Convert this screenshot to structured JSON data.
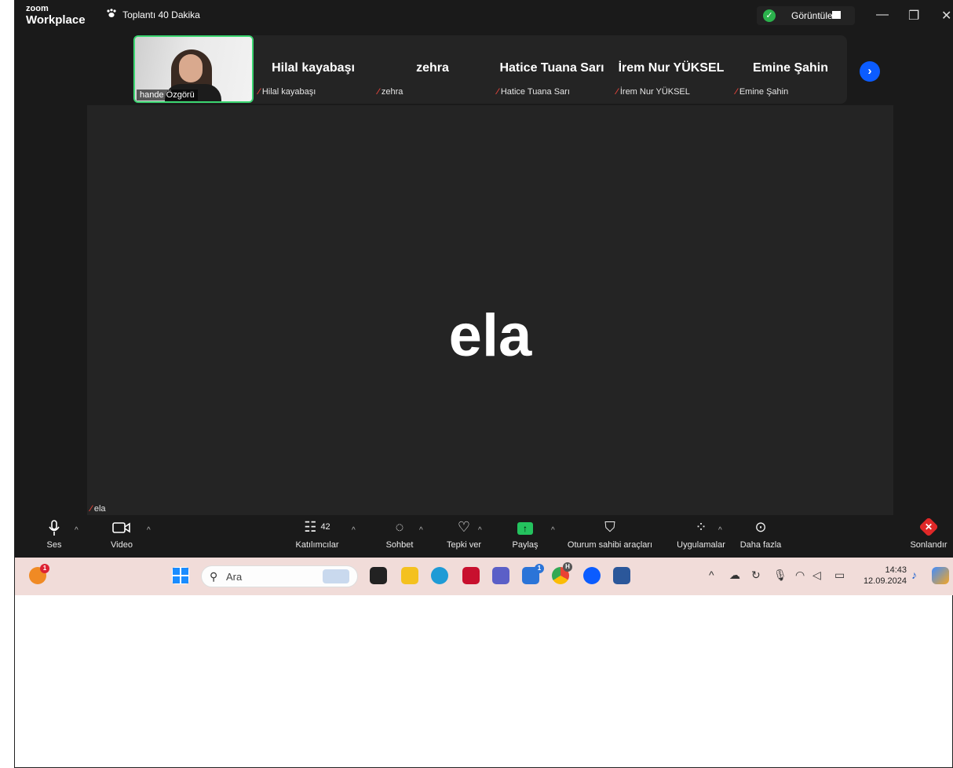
{
  "app": {
    "logo_line1": "zoom",
    "logo_line2": "Workplace",
    "meeting_title": "Toplantı 40 Dakika",
    "view_label": "Görüntüle"
  },
  "window_controls": {
    "minimize": "—",
    "restore": "❐",
    "close": "✕"
  },
  "thumbnails": {
    "self_name": "hande Özgörü",
    "tiles": [
      {
        "display_name": "Hilal kayabaşı",
        "label": "Hilal kayabaşı"
      },
      {
        "display_name": "zehra",
        "label": "zehra"
      },
      {
        "display_name": "Hatice Tuana Sarı",
        "label": "Hatice Tuana Sarı"
      },
      {
        "display_name": "İrem Nur YÜKSEL",
        "label": "İrem Nur YÜKSEL"
      },
      {
        "display_name": "Emine Şahin",
        "label": "Emine Şahin"
      }
    ],
    "next_icon": "chevron-right-icon"
  },
  "speaker": {
    "display_name": "ela",
    "label": "ela"
  },
  "toolbar": {
    "audio": "Ses",
    "video": "Video",
    "participants": "Katılımcılar",
    "participants_count": "42",
    "chat": "Sohbet",
    "reactions": "Tepki ver",
    "share": "Paylaş",
    "host_tools": "Oturum sahibi araçları",
    "apps": "Uygulamalar",
    "more": "Daha fazla",
    "end": "Sonlandır"
  },
  "taskbar": {
    "search_placeholder": "Ara",
    "time": "14:43",
    "date": "12.09.2024",
    "badge_left": "1",
    "badge_store": "1",
    "badge_chrome": "H"
  },
  "colors": {
    "zoom_bg": "#1a1a1a",
    "tile_bg": "#242424",
    "active_speaker_border": "#3bd671",
    "accent_blue": "#0b5cff",
    "share_green": "#24c25e",
    "end_red": "#e02828",
    "taskbar_bg": "#f1dcd9"
  }
}
